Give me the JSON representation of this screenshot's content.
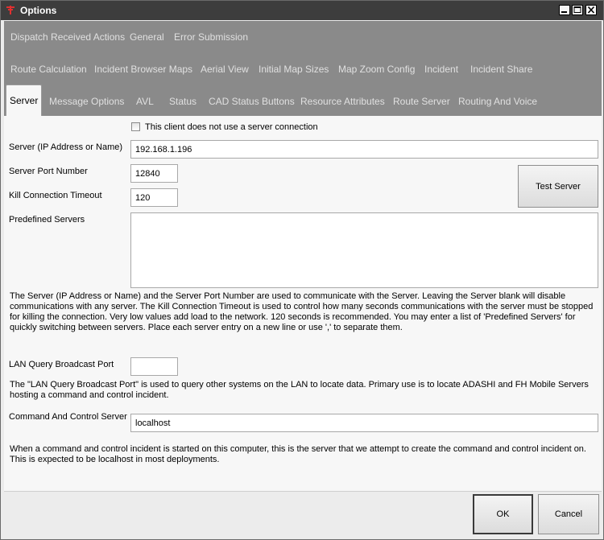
{
  "window": {
    "title": "Options"
  },
  "tabs": {
    "row1": [
      "Dispatch Received Actions",
      "General",
      "Error Submission"
    ],
    "row2": [
      "Route Calculation",
      "Incident Browser Maps",
      "Aerial View",
      "Initial Map Sizes",
      "Map Zoom Config",
      "Incident",
      "Incident Share"
    ],
    "row3": [
      "Server",
      "Message Options",
      "AVL",
      "Status",
      "CAD Status Buttons",
      "Resource Attributes",
      "Route Server",
      "Routing And Voice"
    ]
  },
  "server": {
    "no_server_label": "This client does not use a server connection",
    "server_label": "Server (IP Address or Name)",
    "server_value": "192.168.1.196",
    "port_label": "Server Port Number",
    "port_value": "12840",
    "timeout_label": "Kill Connection Timeout",
    "timeout_value": "120",
    "predefined_label": "Predefined Servers",
    "predefined_value": "",
    "test_button": "Test Server",
    "description": "The Server (IP Address or Name) and the Server Port Number are used to communicate with the Server.  Leaving the Server blank will disable communications with any server.  The Kill Connection Timeout is used to control how many seconds communications with the server must be stopped for killing the connection.  Very low values add load to the network.  120 seconds is recommended.  You may enter a list of 'Predefined Servers' for quickly switching between servers.   Place each server entry on a new line or use ',' to separate them.",
    "lan_label": "LAN Query Broadcast Port",
    "lan_value": "",
    "lan_description": "The \"LAN Query Broadcast Port\" is used to query other systems on the LAN to locate data.   Primary use is to locate ADASHI and FH Mobile Servers hosting a command and control incident.",
    "cc_label": "Command And Control Server",
    "cc_value": "localhost",
    "cc_description": "When a command and control incident is started on this computer, this is the server that we attempt to create the command and control incident on. This is expected to be localhost in most deployments."
  },
  "footer": {
    "ok": "OK",
    "cancel": "Cancel"
  },
  "colors": {
    "titlebar": "#3d3d3d",
    "tabstrip": "#8a8a8a",
    "panel": "#f7f7f7"
  }
}
